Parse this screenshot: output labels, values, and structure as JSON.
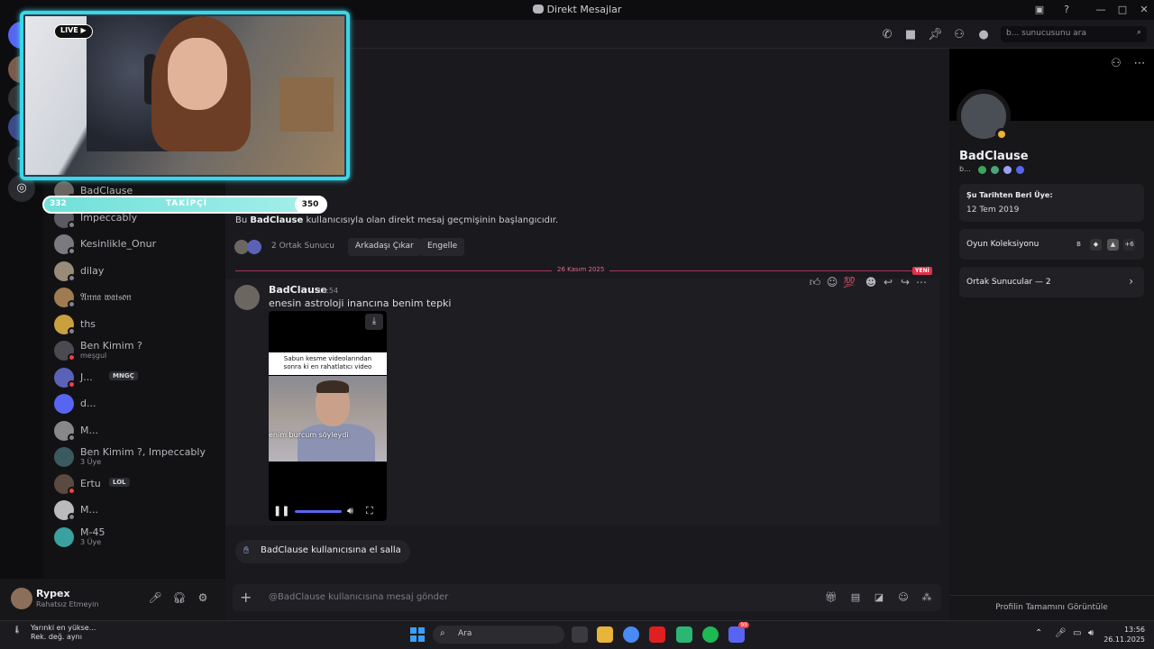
{
  "window": {
    "title": "Direkt Mesajlar"
  },
  "topbar": {
    "search_placeholder": "b... sunucusunu ara"
  },
  "stream_overlay": {
    "live_label": "LIVE",
    "followers_label": "TAKİPÇİ",
    "followers_current": "332",
    "followers_goal": "350"
  },
  "dm_list": [
    {
      "name": "BadClause",
      "sub": "",
      "tag": "",
      "status": "offline",
      "color": "#6c6660"
    },
    {
      "name": "Impeccably",
      "sub": "",
      "tag": "",
      "status": "offline",
      "color": "#5a5a63"
    },
    {
      "name": "Kesinlikle_Onur",
      "sub": "",
      "tag": "",
      "status": "offline",
      "color": "#7a7a80"
    },
    {
      "name": "dilay",
      "sub": "",
      "tag": "",
      "status": "offline",
      "color": "#9a8a78"
    },
    {
      "name": "𝔄𝔫𝔫𝔞 𝔴𝔞𝔱𝔰𝔬𝔫",
      "sub": "",
      "tag": "",
      "status": "offline",
      "color": "#a07a50"
    },
    {
      "name": "ths",
      "sub": "",
      "tag": "",
      "status": "offline",
      "color": "#c9a040"
    },
    {
      "name": "Ben Kimim ?",
      "sub": "meşgul",
      "tag": "",
      "status": "dnd",
      "color": "#4a4a50"
    },
    {
      "name": "J...",
      "sub": "",
      "tag": "MNGÇ",
      "status": "dnd",
      "color": "#5a62b8"
    },
    {
      "name": "d...",
      "sub": "",
      "tag": "",
      "status": "none",
      "color": "#5865f2"
    },
    {
      "name": "M...",
      "sub": "",
      "tag": "",
      "status": "offline",
      "color": "#888"
    },
    {
      "name": "Ben Kimim ?, Impeccably",
      "sub": "3 Üye",
      "tag": "",
      "status": "none",
      "color": "#3a5a60"
    },
    {
      "name": "Ertu",
      "sub": "",
      "tag": "LOL",
      "status": "dnd",
      "color": "#5a4a40"
    },
    {
      "name": "M...",
      "sub": "",
      "tag": "",
      "status": "offline",
      "color": "#bbb"
    },
    {
      "name": "M-45",
      "sub": "3 Üye",
      "tag": "",
      "status": "none",
      "color": "#3aa0a0"
    }
  ],
  "user_panel": {
    "name": "Rypex",
    "status": "Rahatsız Etmeyin"
  },
  "chat": {
    "history_prefix": "Bu",
    "history_user": "BadClause",
    "history_suffix": "kullanıcısıyla olan direkt mesaj geçmişinin başlangıcıdır.",
    "mutual_servers": "2 Ortak Sunucu",
    "remove_friend": "Arkadaşı Çıkar",
    "block": "Engelle",
    "date_divider": "26 Kasım 2025",
    "new_badge": "YENİ",
    "message": {
      "author": "BadClause",
      "time": "13:54",
      "text": "enesin astroloji inancına benim tepki",
      "video_caption_line1": "Sabun kesme videolarından",
      "video_caption_line2": "sonra ki en rahatlatıcı video",
      "video_subtitle": "enim burcum söyleydi"
    },
    "wave_label": "BadClause kullanıcısına el salla",
    "composer_placeholder": "@BadClause kullanıcısına mesaj gönder"
  },
  "profile": {
    "name": "BadClause",
    "tag": "b...",
    "member_since_title": "Şu Tarihten Beri Üye:",
    "member_since_value": "12 Tem 2019",
    "games_title": "Oyun Koleksiyonu",
    "games_more": "+6",
    "mutual_servers": "Ortak Sunucular — 2",
    "full_profile": "Profilin Tamamını Görüntüle"
  },
  "taskbar": {
    "weather_line1": "Yarınki en yükse...",
    "weather_line2": "Rek. değ. aynı",
    "search": "Ara",
    "time": "13:56",
    "date": "26.11.2025",
    "discord_badge": "99"
  },
  "icons": {
    "accent": "#5865f2",
    "overlay": "#3ad6e8",
    "dnd": "#f23f43",
    "idle": "#f0b232"
  }
}
